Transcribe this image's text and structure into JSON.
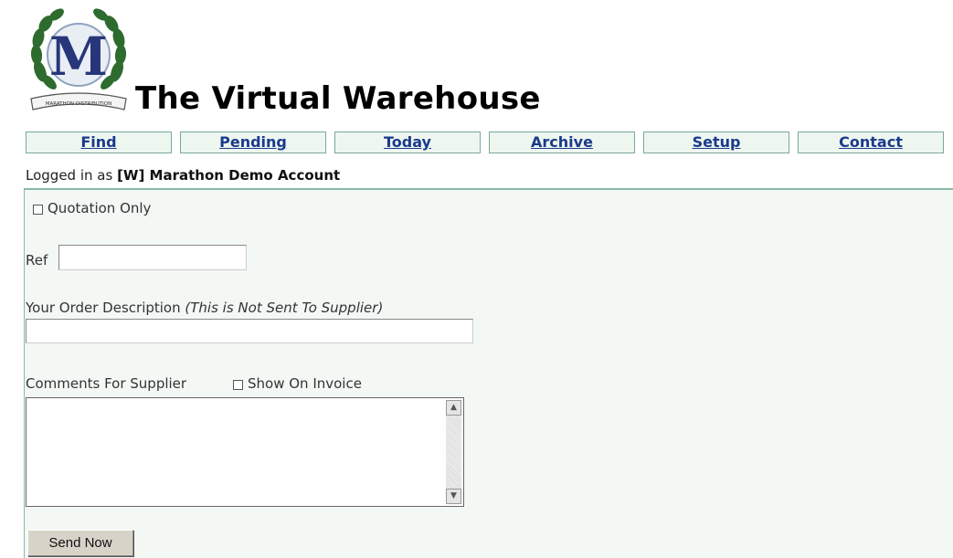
{
  "site": {
    "title": "The Virtual Warehouse",
    "logo_letter": "M",
    "logo_ribbon": "MARATHON DISTRIBUTION"
  },
  "nav": {
    "items": [
      {
        "label": "Find"
      },
      {
        "label": "Pending"
      },
      {
        "label": "Today"
      },
      {
        "label": "Archive"
      },
      {
        "label": "Setup"
      },
      {
        "label": "Contact"
      }
    ]
  },
  "session": {
    "prefix": "Logged in as",
    "account": "[W] Marathon Demo Account"
  },
  "form": {
    "quotation_only_label": "Quotation Only",
    "quotation_only_checked": false,
    "ref_label": "Ref",
    "ref_value": "",
    "description_label": "Your Order Description",
    "description_note": "(This is Not Sent To Supplier)",
    "description_value": "",
    "comments_label": "Comments For Supplier",
    "show_on_invoice_label": "Show On Invoice",
    "show_on_invoice_checked": false,
    "comments_value": "",
    "send_label": "Send Now"
  },
  "colors": {
    "nav_bg": "#eef6f0",
    "nav_border": "#7aa99a",
    "link": "#1a3a8c",
    "panel_bg": "#f3f8f5"
  }
}
